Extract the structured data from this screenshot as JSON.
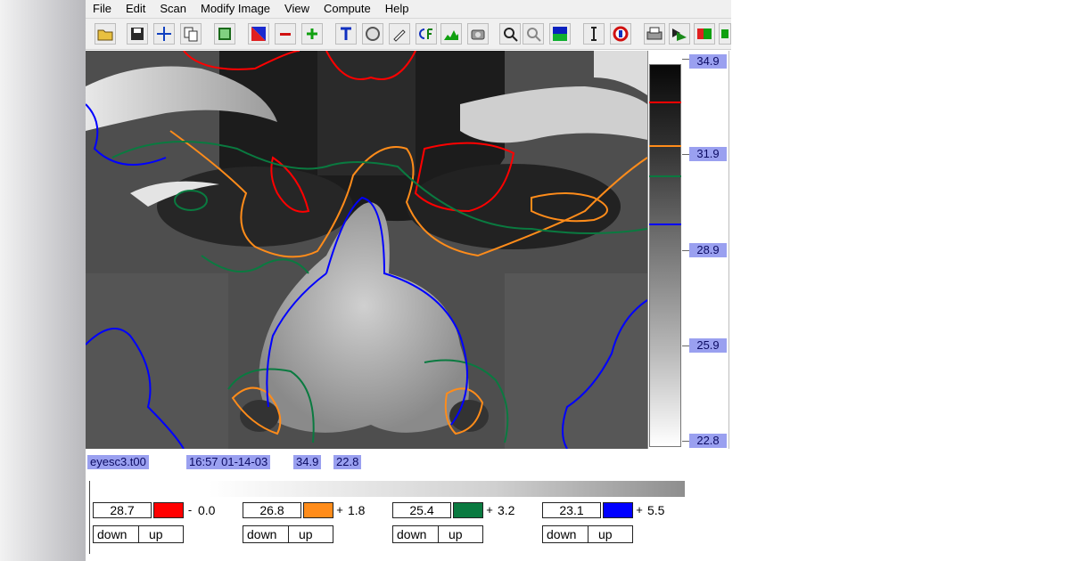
{
  "menu": [
    "File",
    "Edit",
    "Scan",
    "Modify Image",
    "View",
    "Compute",
    "Help"
  ],
  "toolbar_icons": [
    "open-folder-icon",
    "save-icon",
    "crosshair-icon",
    "copy-icon",
    "region-icon",
    "palette-icon",
    "minus-icon",
    "plus-icon",
    "text-tool-icon",
    "aperture-icon",
    "pencil-icon",
    "cf-icon",
    "histogram-icon",
    "camera-icon",
    "zoom-in-icon",
    "zoom-out-icon",
    "color-map-icon",
    "cursor-i-icon",
    "stop-icon",
    "print-icon",
    "palette-stack-icon",
    "rgb-icon",
    "export-icon"
  ],
  "scale": {
    "labels": [
      "34.9",
      "31.9",
      "28.9",
      "25.9",
      "22.8"
    ]
  },
  "status": {
    "filename": "eyesc3.t00",
    "datetime": "16:57 01-14-03",
    "max": "34.9",
    "min": "22.8"
  },
  "isotherms": [
    {
      "value": "28.7",
      "color": "#ff0000",
      "sign": "-",
      "offset": "0.0",
      "down": "down",
      "up": "up"
    },
    {
      "value": "26.8",
      "color": "#ff8c1a",
      "sign": "+",
      "offset": "1.8",
      "down": "down",
      "up": "up"
    },
    {
      "value": "25.4",
      "color": "#0a7a40",
      "sign": "+",
      "offset": "3.2",
      "down": "down",
      "up": "up"
    },
    {
      "value": "23.1",
      "color": "#0000ff",
      "sign": "+",
      "offset": "5.5",
      "down": "down",
      "up": "up"
    }
  ],
  "colors": {
    "status_bg": "#9aa0f0",
    "status_text": "#0b0b62"
  }
}
